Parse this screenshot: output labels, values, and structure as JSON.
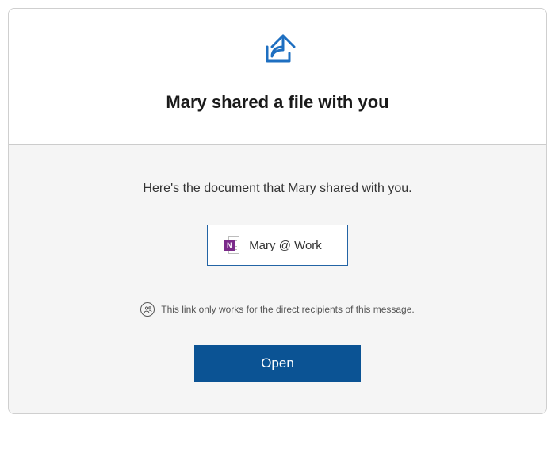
{
  "icons": {
    "share": "share-icon",
    "file_app_letter": "N",
    "recipients": "recipients-icon"
  },
  "header": {
    "title": "Mary shared a file with you"
  },
  "body": {
    "message": "Here's the document that Mary shared with you.",
    "file": {
      "name": "Mary @ Work"
    },
    "notice": "This link only works for the direct recipients of this message.",
    "open_label": "Open"
  },
  "colors": {
    "accent_blue": "#1e6fc1",
    "button_blue": "#0b5394",
    "onenote_purple": "#7b2a8a",
    "body_bg": "#f5f5f5"
  }
}
